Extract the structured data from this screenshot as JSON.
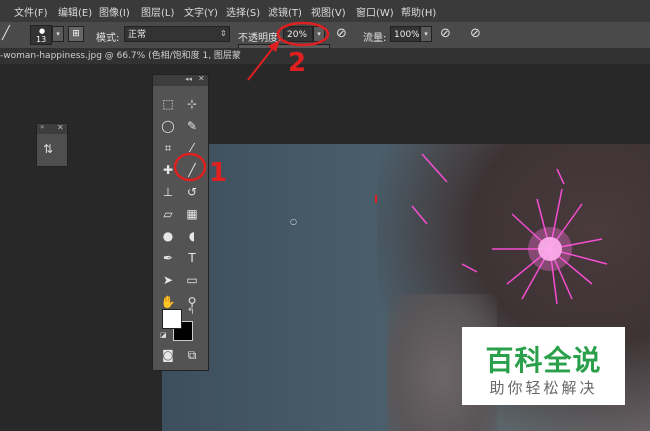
{
  "menu": [
    "文件(F)",
    "编辑(E)",
    "图像(I)",
    "图层(L)",
    "文字(Y)",
    "选择(S)",
    "滤镜(T)",
    "视图(V)",
    "窗口(W)",
    "帮助(H)"
  ],
  "options": {
    "brush_size": "13",
    "mode_label": "模式:",
    "mode_value": "正常",
    "opacity_label": "不透明度:",
    "opacity_value": "20%",
    "flow_label": "流量:",
    "flow_value": "100%",
    "opacity_slider_fraction": 0.2
  },
  "document_tab": "-woman-happiness.jpg @ 66.7% (色相/饱和度 1, 图层蒙",
  "tools_panel": {
    "header_icons": [
      "collapse-icon",
      "close-icon"
    ]
  },
  "annotations": {
    "step1": "1",
    "step2": "2"
  },
  "watermark": {
    "title": "百科全说",
    "subtitle": "助你轻松解决"
  },
  "colors": {
    "annotation_red": "#e02020",
    "watermark_green": "#2aa04a",
    "sparkler_pink": "#ff4fd8"
  }
}
